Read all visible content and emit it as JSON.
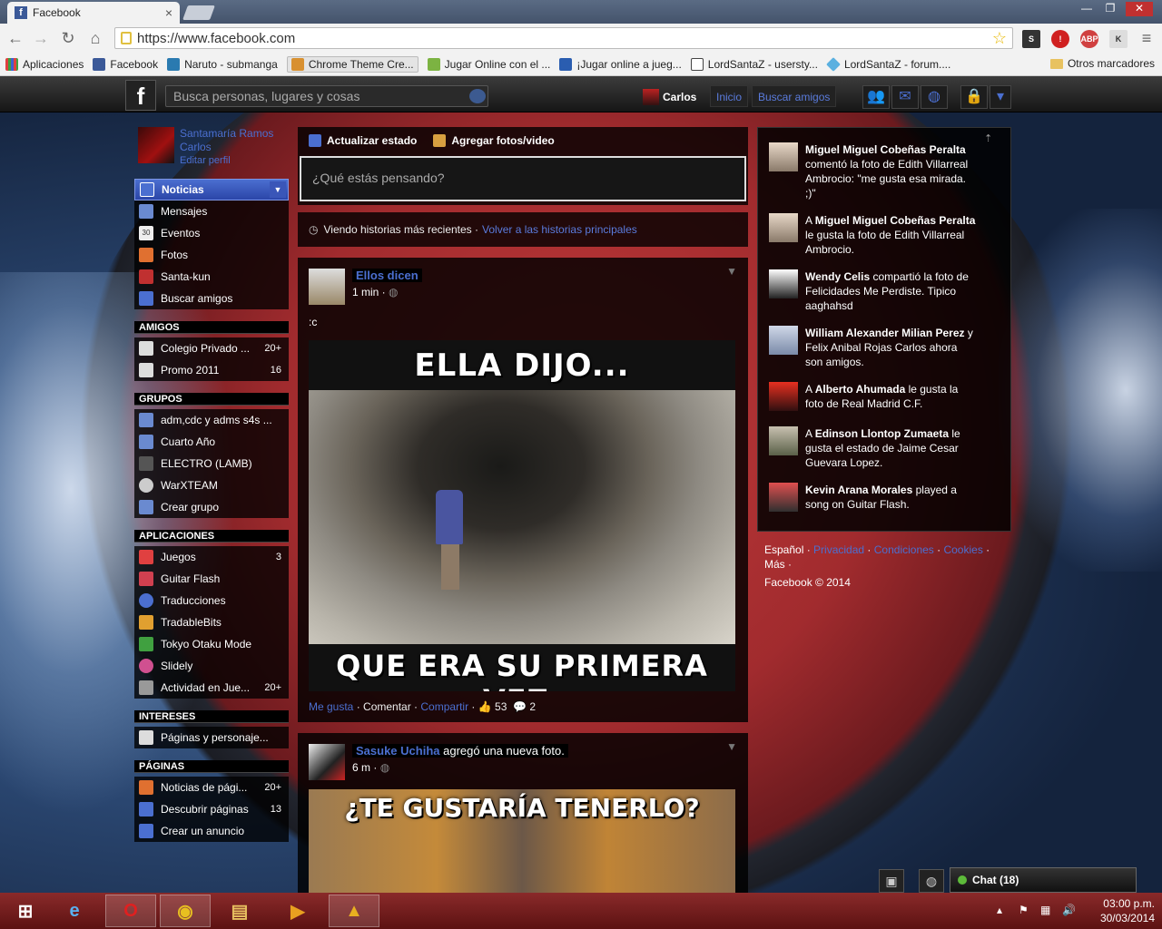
{
  "browser": {
    "tab_title": "Facebook",
    "tab_close": "×",
    "url": "https://www.facebook.com",
    "window_buttons": [
      "—",
      "❐",
      "✕"
    ],
    "bookmarks": [
      {
        "label": "Aplicaciones",
        "icon": "apps-grid-icon",
        "color": "#e04040"
      },
      {
        "label": "Facebook",
        "icon": "facebook-icon",
        "color": "#3b5998"
      },
      {
        "label": "Naruto - submanga",
        "icon": "submanga-icon",
        "color": "#2a7ab0"
      },
      {
        "label": "Chrome Theme Cre...",
        "icon": "chrome-theme-icon",
        "color": "#d89030"
      },
      {
        "label": "Jugar Online con el ...",
        "icon": "puzzle-icon",
        "color": "#7cb342"
      },
      {
        "label": "¡Jugar online a jueg...",
        "icon": "tuenti-icon",
        "color": "#2a5db0"
      },
      {
        "label": "LordSantaZ - usersty...",
        "icon": "page-icon",
        "color": "#444444"
      },
      {
        "label": "LordSantaZ - forum....",
        "icon": "diamond-icon",
        "color": "#5ab0e0"
      }
    ],
    "other_bookmarks": "Otros marcadores"
  },
  "fb": {
    "search_placeholder": "Busca personas, lugares y cosas",
    "user_name": "Carlos",
    "nav_home": "Inicio",
    "nav_find_friends": "Buscar amigos",
    "profile_name": "Santamaría Ramos Carlos",
    "profile_edit": "Editar perfil"
  },
  "left_nav": {
    "favorites": [
      {
        "label": "Noticias",
        "color": "#4b6fd0"
      },
      {
        "label": "Mensajes",
        "color": "#6a8ad0"
      },
      {
        "label": "Eventos",
        "color": "#eeeeee",
        "badge": "30"
      },
      {
        "label": "Fotos",
        "color": "#e07030"
      },
      {
        "label": "Santa-kun",
        "color": "#c03030"
      },
      {
        "label": "Buscar amigos",
        "color": "#4b6fd0"
      }
    ],
    "friends_header": "AMIGOS",
    "friends": [
      {
        "label": "Colegio Privado ...",
        "count": "20+"
      },
      {
        "label": "Promo 2011",
        "count": "16"
      }
    ],
    "groups_header": "GRUPOS",
    "groups": [
      {
        "label": "adm,cdc y adms s4s ..."
      },
      {
        "label": "Cuarto Año"
      },
      {
        "label": "ELECTRO (LAMB)"
      },
      {
        "label": "WarXTEAM"
      },
      {
        "label": "Crear grupo"
      }
    ],
    "apps_header": "APLICACIONES",
    "apps": [
      {
        "label": "Juegos",
        "count": "3",
        "color": "#e04040"
      },
      {
        "label": "Guitar Flash",
        "count": "",
        "color": "#d04050"
      },
      {
        "label": "Traducciones",
        "count": "",
        "color": "#4b6fd0"
      },
      {
        "label": "TradableBits",
        "count": "",
        "color": "#e0a030"
      },
      {
        "label": "Tokyo Otaku Mode",
        "count": "",
        "color": "#40a040"
      },
      {
        "label": "Slidely",
        "count": "",
        "color": "#d05090"
      },
      {
        "label": "Actividad en Jue...",
        "count": "20+",
        "color": "#999999"
      }
    ],
    "interests_header": "INTERESES",
    "interests": [
      {
        "label": "Páginas y personaje..."
      }
    ],
    "pages_header": "PÁGINAS",
    "pages": [
      {
        "label": "Noticias de pági...",
        "count": "20+"
      },
      {
        "label": "Descubrir páginas",
        "count": "13"
      },
      {
        "label": "Crear un anuncio",
        "count": ""
      }
    ]
  },
  "composer": {
    "tab_status": "Actualizar estado",
    "tab_photo": "Agregar fotos/video",
    "placeholder": "¿Qué estás pensando?"
  },
  "sort": {
    "text": "Viendo historias más recientes ·",
    "link": "Volver a las historias principales"
  },
  "posts": [
    {
      "author": "Ellos dicen",
      "action": "",
      "time": "1 min ·",
      "text": ":c",
      "meme_top": "ELLA DIJO...",
      "meme_bottom": "QUE ERA SU PRIMERA VEZ.",
      "like": "Me gusta",
      "comment": "Comentar",
      "share": "Compartir",
      "likes_count": "53",
      "comments_count": "2"
    },
    {
      "author": "Sasuke Uchiha",
      "action": "agregó una nueva foto.",
      "time": "6 m ·",
      "meme_top": "¿TE GUSTARÍA TENERLO?"
    }
  ],
  "ticker": [
    {
      "bold": "Miguel Miguel Cobeñas Peralta",
      "rest": " comentó la foto de Edith Villarreal Ambrocio: \"me gusta esa mirada. ;)\""
    },
    {
      "pre": "A ",
      "bold": "Miguel Miguel Cobeñas Peralta",
      "rest": " le gusta la foto de Edith Villarreal Ambrocio."
    },
    {
      "bold": "Wendy Celis",
      "rest": " compartió la foto de Felicidades Me Perdiste. Tipico aaghahsd"
    },
    {
      "bold": "William Alexander Milian Perez",
      "rest": " y Felix Anibal Rojas Carlos ahora son amigos."
    },
    {
      "pre": "A ",
      "bold": "Alberto Ahumada",
      "rest": " le gusta la foto de Real Madrid C.F."
    },
    {
      "pre": "A ",
      "bold": "Edinson Llontop Zumaeta",
      "rest": " le gusta el estado de Jaime Cesar Guevara Lopez."
    },
    {
      "bold": "Kevin Arana Morales",
      "rest": " played a song on Guitar Flash."
    }
  ],
  "footer": {
    "lang": "Español",
    "privacy": "Privacidad",
    "terms": "Condiciones",
    "cookies": "Cookies",
    "more": "Más",
    "copyright": "Facebook © 2014"
  },
  "chat": {
    "label": "Chat (18)"
  },
  "taskbar": {
    "time": "03:00 p.m.",
    "date": "30/03/2014"
  },
  "colors": {
    "accent": "#4b6fd0",
    "taskbar": "#7a1e1e"
  }
}
